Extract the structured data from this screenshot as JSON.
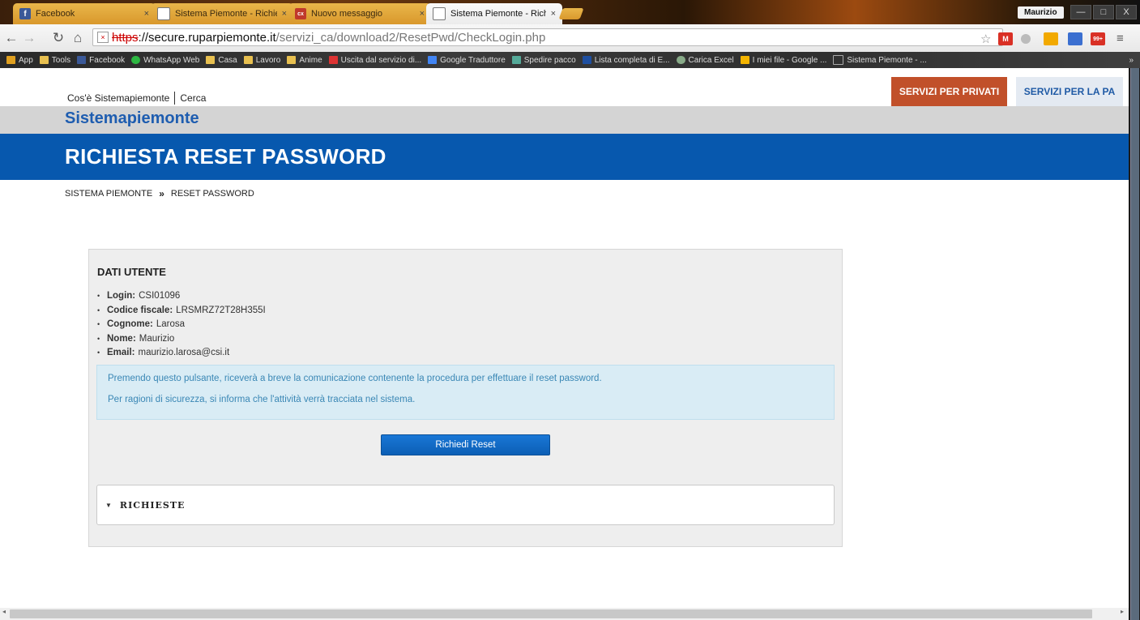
{
  "browser": {
    "tabs": [
      {
        "label": "Facebook",
        "icon": "facebook-icon",
        "active": false
      },
      {
        "label": "Sistema Piemonte - Richie",
        "icon": "page-icon",
        "active": false
      },
      {
        "label": "Nuovo messaggio",
        "icon": "mail-icon",
        "active": false
      },
      {
        "label": "Sistema Piemonte - Richie",
        "icon": "page-icon",
        "active": true
      }
    ],
    "tab_close": "×",
    "user": "Maurizio",
    "window_buttons": [
      "—",
      "□",
      "X"
    ],
    "address": {
      "scheme": "https",
      "host": "://secure.ruparpiemonte.it",
      "path": "/servizi_ca/download2/ResetPwd/CheckLogin.php"
    },
    "bookmarks": [
      {
        "label": "App",
        "color": "#e0a020"
      },
      {
        "label": "Tools",
        "color": "#e8c050"
      },
      {
        "label": "Facebook",
        "color": "#3b5998"
      },
      {
        "label": "WhatsApp Web",
        "color": "#2db742"
      },
      {
        "label": "Casa",
        "color": "#e8c050"
      },
      {
        "label": "Lavoro",
        "color": "#e8c050"
      },
      {
        "label": "Anime",
        "color": "#e8c050"
      },
      {
        "label": "Uscita dal servizio di...",
        "color": "#d33"
      },
      {
        "label": "Google Traduttore",
        "color": "#4285f4"
      },
      {
        "label": "Spedire pacco",
        "color": "#5a9"
      },
      {
        "label": "Lista completa di E...",
        "color": "#1e4fa0"
      },
      {
        "label": "Carica Excel",
        "color": "#8a8"
      },
      {
        "label": "I miei file - Google ...",
        "color": "#f4b400"
      },
      {
        "label": "Sistema Piemonte - ...",
        "color": "#ccc"
      }
    ],
    "bookmarks_overflow": "»"
  },
  "page": {
    "topnav": {
      "about": "Cos'è Sistemapiemonte",
      "search": "Cerca"
    },
    "services": {
      "private": "SERVIZI PER PRIVATI",
      "pa": "SERVIZI PER LA PA"
    },
    "brand": "Sistemapiemonte",
    "title": "RICHIESTA RESET PASSWORD",
    "breadcrumb": {
      "home": "SISTEMA PIEMONTE",
      "separator": "»",
      "current": "RESET PASSWORD"
    },
    "panel": {
      "title": "DATI UTENTE",
      "fields": [
        {
          "key": "Login:",
          "value": "CSI01096"
        },
        {
          "key": "Codice fiscale:",
          "value": "LRSMRZ72T28H355I"
        },
        {
          "key": "Cognome:",
          "value": "Larosa"
        },
        {
          "key": "Nome:",
          "value": "Maurizio"
        },
        {
          "key": "Email:",
          "value": "maurizio.larosa@csi.it"
        }
      ],
      "info_line1": "Premendo questo pulsante, riceverà a breve la comunicazione contenente la procedura per effettuare il reset password.",
      "info_line2": "Per ragioni di sicurezza, si informa che l'attività verrà tracciata nel sistema.",
      "reset_button": "Richiedi Reset",
      "accordion_title": "RICHIESTE"
    }
  },
  "colors": {
    "brand_blue": "#0758ae",
    "private_orange": "#c1502a",
    "info_bg": "#d9ecf5",
    "info_text": "#3a87b5"
  }
}
